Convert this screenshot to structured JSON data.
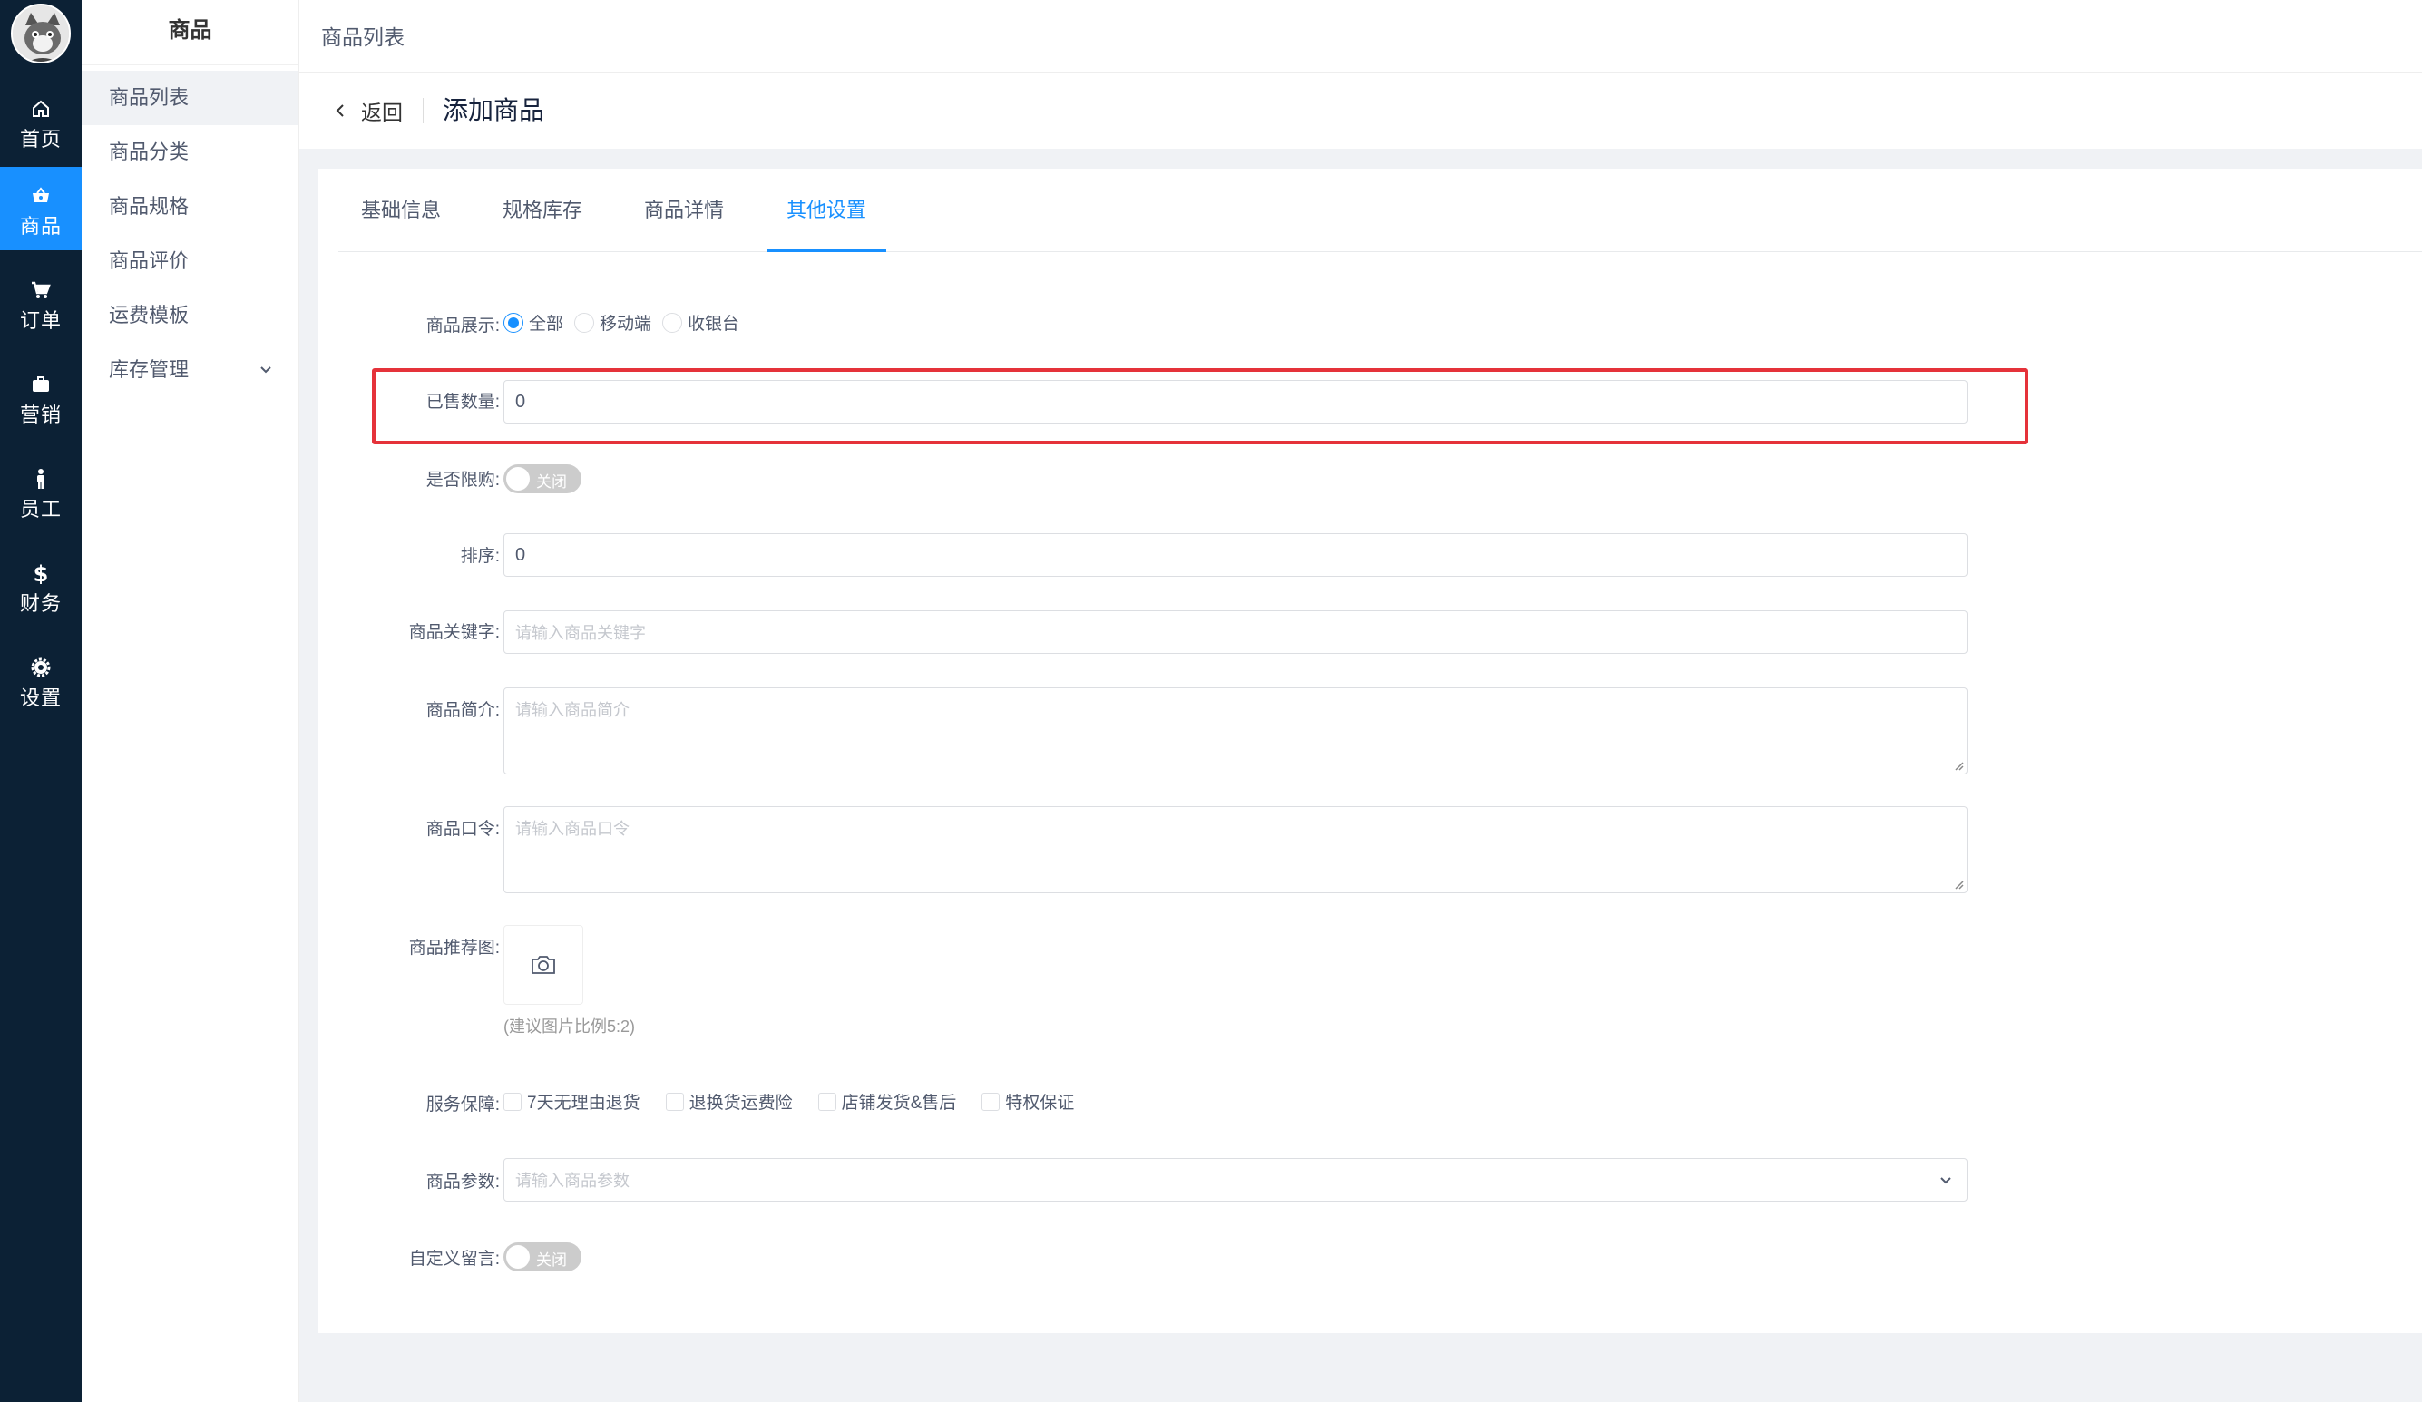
{
  "sidebar": {
    "items": [
      {
        "label": "首页",
        "icon": "home-icon"
      },
      {
        "label": "商品",
        "icon": "basket-icon"
      },
      {
        "label": "订单",
        "icon": "cart-icon"
      },
      {
        "label": "营销",
        "icon": "briefcase-icon"
      },
      {
        "label": "员工",
        "icon": "person-icon"
      },
      {
        "label": "财务",
        "icon": "dollar-icon"
      },
      {
        "label": "设置",
        "icon": "gear-icon"
      }
    ],
    "active_index": 1
  },
  "submenu": {
    "title": "商品",
    "items": [
      {
        "label": "商品列表"
      },
      {
        "label": "商品分类"
      },
      {
        "label": "商品规格"
      },
      {
        "label": "商品评价"
      },
      {
        "label": "运费模板"
      },
      {
        "label": "库存管理"
      }
    ]
  },
  "header": {
    "breadcrumb": "商品列表"
  },
  "page": {
    "back_label": "返回",
    "title": "添加商品"
  },
  "tabs": [
    {
      "label": "基础信息"
    },
    {
      "label": "规格库存"
    },
    {
      "label": "商品详情"
    },
    {
      "label": "其他设置"
    }
  ],
  "form": {
    "display": {
      "label": "商品展示:",
      "options": [
        "全部",
        "移动端",
        "收银台"
      ],
      "selected": "全部"
    },
    "sold": {
      "label": "已售数量:",
      "value": "0"
    },
    "limit": {
      "label": "是否限购:",
      "switch_text": "关闭"
    },
    "sort": {
      "label": "排序:",
      "value": "0"
    },
    "keywords": {
      "label": "商品关键字:",
      "placeholder": "请输入商品关键字"
    },
    "intro": {
      "label": "商品简介:",
      "placeholder": "请输入商品简介"
    },
    "password": {
      "label": "商品口令:",
      "placeholder": "请输入商品口令"
    },
    "recommend": {
      "label": "商品推荐图:",
      "hint": "(建议图片比例5:2)"
    },
    "service": {
      "label": "服务保障:",
      "options": [
        "7天无理由退货",
        "退换货运费险",
        "店铺发货&售后",
        "特权保证"
      ]
    },
    "params": {
      "label": "商品参数:",
      "placeholder": "请输入商品参数"
    },
    "message": {
      "label": "自定义留言:",
      "switch_text": "关闭"
    }
  },
  "colors": {
    "accent": "#1890ff",
    "sidebar_bg": "#0c2135",
    "highlight": "#e5323a"
  }
}
